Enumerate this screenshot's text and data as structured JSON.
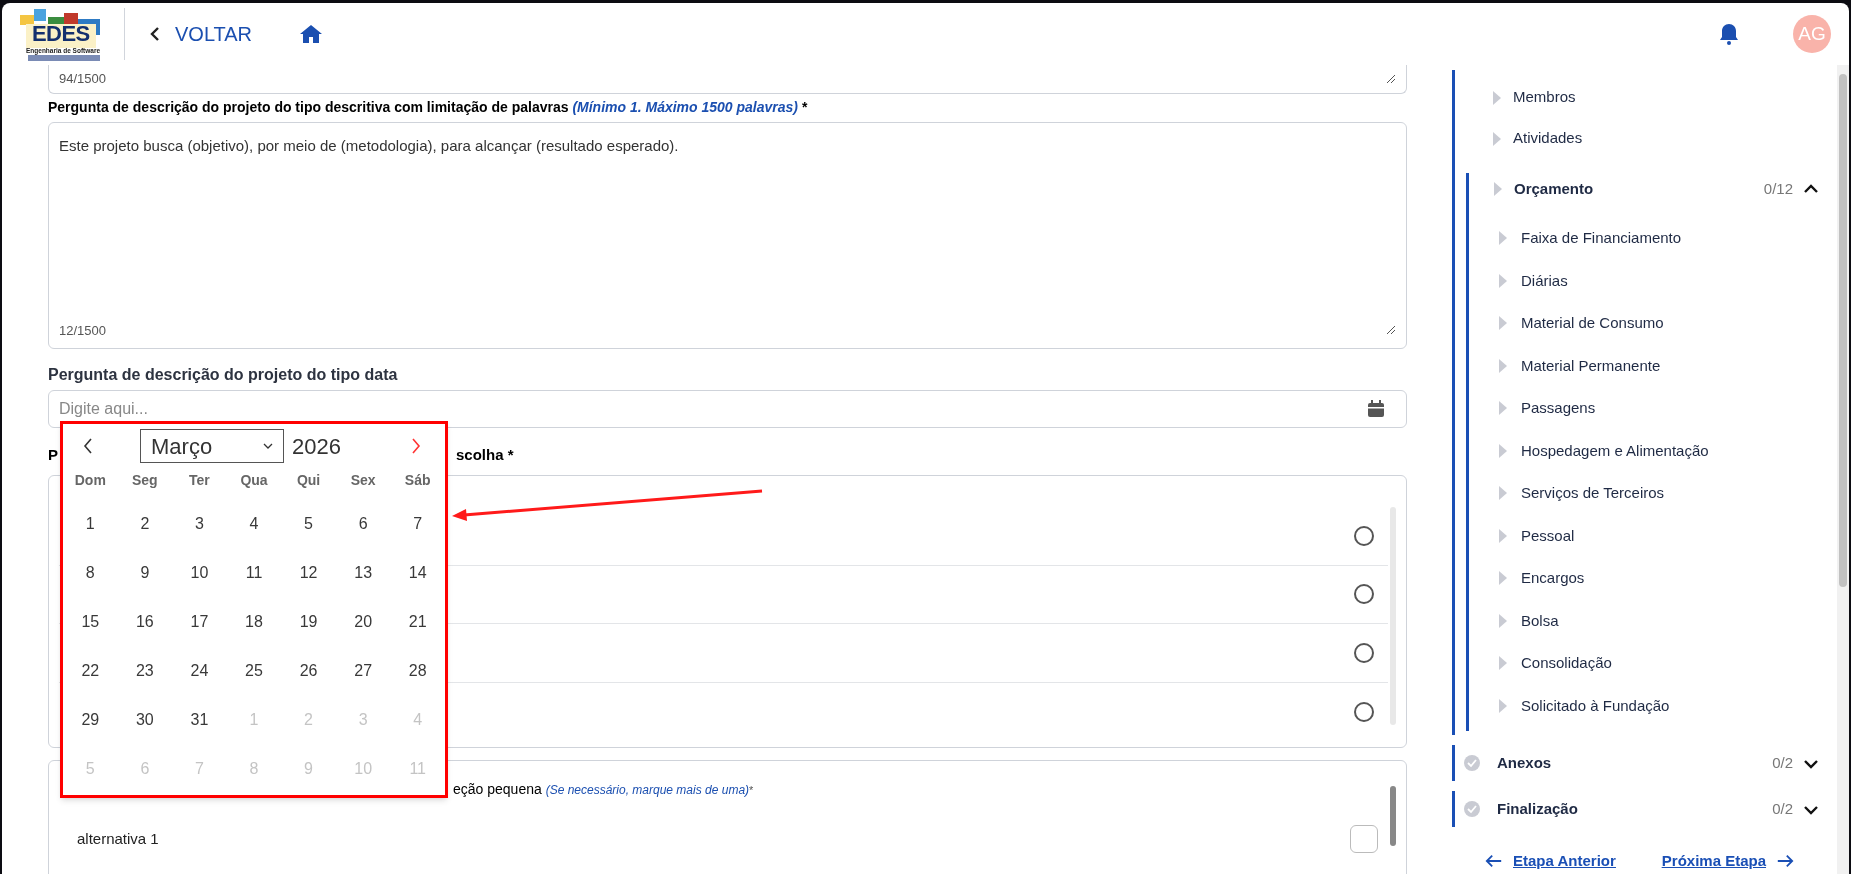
{
  "header": {
    "logo_title": "EDES",
    "logo_subtitle": "Engenharia de Software",
    "back_label": "VOLTAR",
    "avatar_initials": "AG"
  },
  "form": {
    "previous_field_counter": "94/1500",
    "description_question": {
      "label": "Pergunta de descrição do projeto do tipo descritiva com limitação de palavras",
      "hint": "(Mínimo 1. Máximo 1500 palavras)",
      "required_mark": "*",
      "value": "Este projeto busca (objetivo), por meio de (metodologia), para alcançar (resultado esperado).",
      "counter": "12/1500"
    },
    "date_question": {
      "label": "Pergunta de descrição do projeto do tipo data",
      "placeholder": "Digite aqui..."
    },
    "single_choice_question": {
      "label_start": "P",
      "label_end": "scolha *",
      "options": [
        {
          "selected": false
        },
        {
          "selected": false
        },
        {
          "selected": false
        },
        {
          "selected": false
        }
      ]
    },
    "multiple_choice_question": {
      "label_end": "eção pequena",
      "hint": "(Se necessário, marque mais de uma)",
      "required_mark": "*",
      "options": [
        {
          "label": "alternativa 1",
          "checked": false
        }
      ]
    }
  },
  "date_picker": {
    "month": "Março",
    "year": "2026",
    "weekdays": [
      "Dom",
      "Seg",
      "Ter",
      "Qua",
      "Qui",
      "Sex",
      "Sáb"
    ],
    "days": [
      {
        "label": "1",
        "outside_month": false
      },
      {
        "label": "2",
        "outside_month": false
      },
      {
        "label": "3",
        "outside_month": false
      },
      {
        "label": "4",
        "outside_month": false
      },
      {
        "label": "5",
        "outside_month": false
      },
      {
        "label": "6",
        "outside_month": false
      },
      {
        "label": "7",
        "outside_month": false
      },
      {
        "label": "8",
        "outside_month": false
      },
      {
        "label": "9",
        "outside_month": false
      },
      {
        "label": "10",
        "outside_month": false
      },
      {
        "label": "11",
        "outside_month": false
      },
      {
        "label": "12",
        "outside_month": false
      },
      {
        "label": "13",
        "outside_month": false
      },
      {
        "label": "14",
        "outside_month": false
      },
      {
        "label": "15",
        "outside_month": false
      },
      {
        "label": "16",
        "outside_month": false
      },
      {
        "label": "17",
        "outside_month": false
      },
      {
        "label": "18",
        "outside_month": false
      },
      {
        "label": "19",
        "outside_month": false
      },
      {
        "label": "20",
        "outside_month": false
      },
      {
        "label": "21",
        "outside_month": false
      },
      {
        "label": "22",
        "outside_month": false
      },
      {
        "label": "23",
        "outside_month": false
      },
      {
        "label": "24",
        "outside_month": false
      },
      {
        "label": "25",
        "outside_month": false
      },
      {
        "label": "26",
        "outside_month": false
      },
      {
        "label": "27",
        "outside_month": false
      },
      {
        "label": "28",
        "outside_month": false
      },
      {
        "label": "29",
        "outside_month": false
      },
      {
        "label": "30",
        "outside_month": false
      },
      {
        "label": "31",
        "outside_month": false
      },
      {
        "label": "1",
        "outside_month": true
      },
      {
        "label": "2",
        "outside_month": true
      },
      {
        "label": "3",
        "outside_month": true
      },
      {
        "label": "4",
        "outside_month": true
      },
      {
        "label": "5",
        "outside_month": true
      },
      {
        "label": "6",
        "outside_month": true
      },
      {
        "label": "7",
        "outside_month": true
      },
      {
        "label": "8",
        "outside_month": true
      },
      {
        "label": "9",
        "outside_month": true
      },
      {
        "label": "10",
        "outside_month": true
      },
      {
        "label": "11",
        "outside_month": true
      }
    ]
  },
  "sidebar": {
    "sections": [
      {
        "kind": "group",
        "children": [
          {
            "label": "Membros"
          },
          {
            "label": "Atividades"
          },
          {
            "label": "Orçamento",
            "count": "0/12",
            "expanded": true,
            "children": [
              {
                "label": "Faixa de Financiamento"
              },
              {
                "label": "Diárias"
              },
              {
                "label": "Material de Consumo"
              },
              {
                "label": "Material Permanente"
              },
              {
                "label": "Passagens"
              },
              {
                "label": "Hospedagem e Alimentação"
              },
              {
                "label": "Serviços de Terceiros"
              },
              {
                "label": "Pessoal"
              },
              {
                "label": "Encargos"
              },
              {
                "label": "Bolsa"
              },
              {
                "label": "Consolidação"
              },
              {
                "label": "Solicitado à Fundação"
              }
            ]
          }
        ]
      },
      {
        "kind": "step",
        "label": "Anexos",
        "count": "0/2",
        "expanded": false
      },
      {
        "kind": "step",
        "label": "Finalização",
        "count": "0/2",
        "expanded": false
      }
    ],
    "nav": {
      "previous": "Etapa Anterior",
      "next": "Próxima Etapa"
    }
  }
}
